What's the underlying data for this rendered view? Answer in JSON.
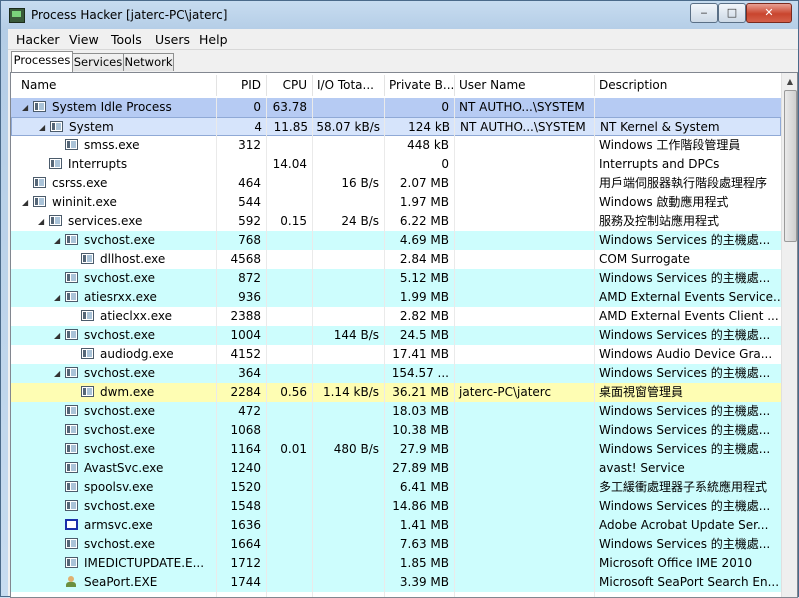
{
  "window": {
    "title": "Process Hacker [jaterc-PC\\jaterc]"
  },
  "menu": [
    "Hacker",
    "View",
    "Tools",
    "Users",
    "Help"
  ],
  "tabs": [
    "Processes",
    "Services",
    "Network"
  ],
  "columns": {
    "name": "Name",
    "pid": "PID",
    "cpu": "CPU",
    "io": "I/O Tota...",
    "priv": "Private B...",
    "user": "User Name",
    "desc": "Description"
  },
  "colors": {
    "services": "#cdfdfd",
    "selected": "#b6cbf3",
    "own": "#fefdb3"
  },
  "processes": [
    {
      "name": "System Idle Process",
      "pid": "0",
      "cpu": "63.78",
      "io": "",
      "priv": "0",
      "user": "NT AUTHO...\\SYSTEM",
      "desc": "",
      "depth": 0,
      "expand": "open",
      "color": "blue",
      "icon": "process-icon"
    },
    {
      "name": "System",
      "pid": "4",
      "cpu": "11.85",
      "io": "58.07 kB/s",
      "priv": "124 kB",
      "user": "NT AUTHO...\\SYSTEM",
      "desc": "NT Kernel & System",
      "depth": 1,
      "expand": "open",
      "color": "blue2",
      "icon": "process-icon"
    },
    {
      "name": "smss.exe",
      "pid": "312",
      "cpu": "",
      "io": "",
      "priv": "448 kB",
      "user": "",
      "desc": "Windows 工作階段管理員",
      "depth": 2,
      "expand": "",
      "color": "white",
      "icon": "process-icon"
    },
    {
      "name": "Interrupts",
      "pid": "",
      "cpu": "14.04",
      "io": "",
      "priv": "0",
      "user": "",
      "desc": "Interrupts and DPCs",
      "depth": 1,
      "expand": "",
      "color": "white",
      "icon": "process-icon"
    },
    {
      "name": "csrss.exe",
      "pid": "464",
      "cpu": "",
      "io": "16 B/s",
      "priv": "2.07 MB",
      "user": "",
      "desc": "用戶端伺服器執行階段處理程序",
      "depth": 0,
      "expand": "",
      "color": "white",
      "icon": "process-icon"
    },
    {
      "name": "wininit.exe",
      "pid": "544",
      "cpu": "",
      "io": "",
      "priv": "1.97 MB",
      "user": "",
      "desc": "Windows 啟動應用程式",
      "depth": 0,
      "expand": "open",
      "color": "white",
      "icon": "process-icon"
    },
    {
      "name": "services.exe",
      "pid": "592",
      "cpu": "0.15",
      "io": "24 B/s",
      "priv": "6.22 MB",
      "user": "",
      "desc": "服務及控制站應用程式",
      "depth": 1,
      "expand": "open",
      "color": "white",
      "icon": "process-icon"
    },
    {
      "name": "svchost.exe",
      "pid": "768",
      "cpu": "",
      "io": "",
      "priv": "4.69 MB",
      "user": "",
      "desc": "Windows Services 的主機處...",
      "depth": 2,
      "expand": "open",
      "color": "cyan",
      "icon": "process-icon"
    },
    {
      "name": "dllhost.exe",
      "pid": "4568",
      "cpu": "",
      "io": "",
      "priv": "2.84 MB",
      "user": "",
      "desc": "COM Surrogate",
      "depth": 3,
      "expand": "",
      "color": "white",
      "icon": "process-icon"
    },
    {
      "name": "svchost.exe",
      "pid": "872",
      "cpu": "",
      "io": "",
      "priv": "5.12 MB",
      "user": "",
      "desc": "Windows Services 的主機處...",
      "depth": 2,
      "expand": "",
      "color": "cyan",
      "icon": "process-icon"
    },
    {
      "name": "atiesrxx.exe",
      "pid": "936",
      "cpu": "",
      "io": "",
      "priv": "1.99 MB",
      "user": "",
      "desc": "AMD External Events Service...",
      "depth": 2,
      "expand": "open",
      "color": "cyan",
      "icon": "process-icon"
    },
    {
      "name": "atieclxx.exe",
      "pid": "2388",
      "cpu": "",
      "io": "",
      "priv": "2.82 MB",
      "user": "",
      "desc": "AMD External Events Client ...",
      "depth": 3,
      "expand": "",
      "color": "white",
      "icon": "process-icon"
    },
    {
      "name": "svchost.exe",
      "pid": "1004",
      "cpu": "",
      "io": "144 B/s",
      "priv": "24.5 MB",
      "user": "",
      "desc": "Windows Services 的主機處...",
      "depth": 2,
      "expand": "open",
      "color": "cyan",
      "icon": "process-icon"
    },
    {
      "name": "audiodg.exe",
      "pid": "4152",
      "cpu": "",
      "io": "",
      "priv": "17.41 MB",
      "user": "",
      "desc": "Windows Audio Device Gra...",
      "depth": 3,
      "expand": "",
      "color": "white",
      "icon": "process-icon"
    },
    {
      "name": "svchost.exe",
      "pid": "364",
      "cpu": "",
      "io": "",
      "priv": "154.57 ...",
      "user": "",
      "desc": "Windows Services 的主機處...",
      "depth": 2,
      "expand": "open",
      "color": "cyan",
      "icon": "process-icon"
    },
    {
      "name": "dwm.exe",
      "pid": "2284",
      "cpu": "0.56",
      "io": "1.14 kB/s",
      "priv": "36.21 MB",
      "user": "jaterc-PC\\jaterc",
      "desc": "桌面視窗管理員",
      "depth": 3,
      "expand": "",
      "color": "yellow",
      "icon": "process-icon"
    },
    {
      "name": "svchost.exe",
      "pid": "472",
      "cpu": "",
      "io": "",
      "priv": "18.03 MB",
      "user": "",
      "desc": "Windows Services 的主機處...",
      "depth": 2,
      "expand": "",
      "color": "cyan",
      "icon": "process-icon"
    },
    {
      "name": "svchost.exe",
      "pid": "1068",
      "cpu": "",
      "io": "",
      "priv": "10.38 MB",
      "user": "",
      "desc": "Windows Services 的主機處...",
      "depth": 2,
      "expand": "",
      "color": "cyan",
      "icon": "process-icon"
    },
    {
      "name": "svchost.exe",
      "pid": "1164",
      "cpu": "0.01",
      "io": "480 B/s",
      "priv": "27.9 MB",
      "user": "",
      "desc": "Windows Services 的主機處...",
      "depth": 2,
      "expand": "",
      "color": "cyan",
      "icon": "process-icon"
    },
    {
      "name": "AvastSvc.exe",
      "pid": "1240",
      "cpu": "",
      "io": "",
      "priv": "27.89 MB",
      "user": "",
      "desc": "avast! Service",
      "depth": 2,
      "expand": "",
      "color": "cyan",
      "icon": "process-icon"
    },
    {
      "name": "spoolsv.exe",
      "pid": "1520",
      "cpu": "",
      "io": "",
      "priv": "6.41 MB",
      "user": "",
      "desc": "多工緩衝處理器子系統應用程式",
      "depth": 2,
      "expand": "",
      "color": "cyan",
      "icon": "process-icon"
    },
    {
      "name": "svchost.exe",
      "pid": "1548",
      "cpu": "",
      "io": "",
      "priv": "14.86 MB",
      "user": "",
      "desc": "Windows Services 的主機處...",
      "depth": 2,
      "expand": "",
      "color": "cyan",
      "icon": "process-icon"
    },
    {
      "name": "armsvc.exe",
      "pid": "1636",
      "cpu": "",
      "io": "",
      "priv": "1.41 MB",
      "user": "",
      "desc": "Adobe Acrobat Update Ser...",
      "depth": 2,
      "expand": "",
      "color": "cyan",
      "icon": "blank-window-icon"
    },
    {
      "name": "svchost.exe",
      "pid": "1664",
      "cpu": "",
      "io": "",
      "priv": "7.63 MB",
      "user": "",
      "desc": "Windows Services 的主機處...",
      "depth": 2,
      "expand": "",
      "color": "cyan",
      "icon": "process-icon"
    },
    {
      "name": "IMEDICTUPDATE.E...",
      "pid": "1712",
      "cpu": "",
      "io": "",
      "priv": "1.85 MB",
      "user": "",
      "desc": "Microsoft Office IME 2010",
      "depth": 2,
      "expand": "",
      "color": "cyan",
      "icon": "process-icon"
    },
    {
      "name": "SeaPort.EXE",
      "pid": "1744",
      "cpu": "",
      "io": "",
      "priv": "3.39 MB",
      "user": "",
      "desc": "Microsoft SeaPort Search En...",
      "depth": 2,
      "expand": "",
      "color": "cyan",
      "icon": "person-icon"
    }
  ]
}
